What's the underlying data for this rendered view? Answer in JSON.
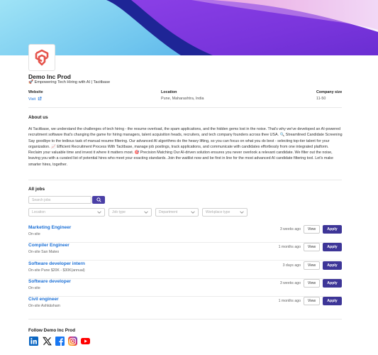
{
  "company": {
    "name": "Demo Inc Prod",
    "tagline": "🚀 Empowering Tech Hiring with AI | Tacitbase"
  },
  "meta": {
    "website_label": "Website",
    "website_value": "Visit",
    "location_label": "Location",
    "location_value": "Pune, Maharashtra, India",
    "size_label": "Company size",
    "size_value": "11-50"
  },
  "about": {
    "title": "About us",
    "text": "At Tacitbase, we understand the challenges of tech hiring - the resume overload, the spam applications, and the hidden gems lost in the noise. That's why we've developed an AI-powered recruitment software that's changing the game for hiring managers, talent acquisition heads, recruiters, and tech company founders across thee USA. 🔍 Streamlined Candidate Screening Say goodbye to the tedious task of manual resume filtering. Our advanced AI algorithms do the heavy lifting, so you can focus on what you do best - selecting top-tier talent for your organization. 📈 Efficient Recruitment Process With Tacitbase, manage job postings, track applications, and communicate with candidates effortlessly from one integrated platform. Reclaim your valuable time and invest it where it matters most. 🎯 Precision Matching Our AI-driven solution ensures you never overlook a relevant candidate. We filter out the noise, leaving you with a curated list of potential hires who meet your exacting standards. Join the waitlist now and be first in line for the most advanced AI candidate filtering tool. Let's make smarter hires, together."
  },
  "jobs_section": {
    "title": "All jobs",
    "search_placeholder": "Search jobs",
    "filters": {
      "location": "Location",
      "job_type": "Job type",
      "department": "Department",
      "workplace_type": "Workplace type"
    },
    "view_label": "View",
    "apply_label": "Apply",
    "jobs": [
      {
        "title": "Marketing Engineer",
        "meta": "On-site",
        "posted": "3 weeks ago"
      },
      {
        "title": "Compiler Engineer",
        "meta": "On-site  San Mateo",
        "posted": "1 months ago"
      },
      {
        "title": "Software developer intern",
        "meta": "On-site  Pune $20K - $30K(annual)",
        "posted": "3 days ago"
      },
      {
        "title": "Software developer",
        "meta": "On-site",
        "posted": "3 weeks ago"
      },
      {
        "title": "Civil engineer",
        "meta": "On-site  Ashkāsham",
        "posted": "1 months ago"
      }
    ]
  },
  "follow": {
    "title": "Follow Demo Inc Prod",
    "icons": [
      "linkedin-icon",
      "x-icon",
      "facebook-icon",
      "instagram-icon",
      "youtube-icon"
    ]
  },
  "colors": {
    "accent": "#3d3597",
    "link": "#1a6fd6",
    "banner_light": "#7fd3f0",
    "banner_purple": "#7b3fe0",
    "banner_navy": "#1a1f8a",
    "logo_red": "#e5534b"
  }
}
